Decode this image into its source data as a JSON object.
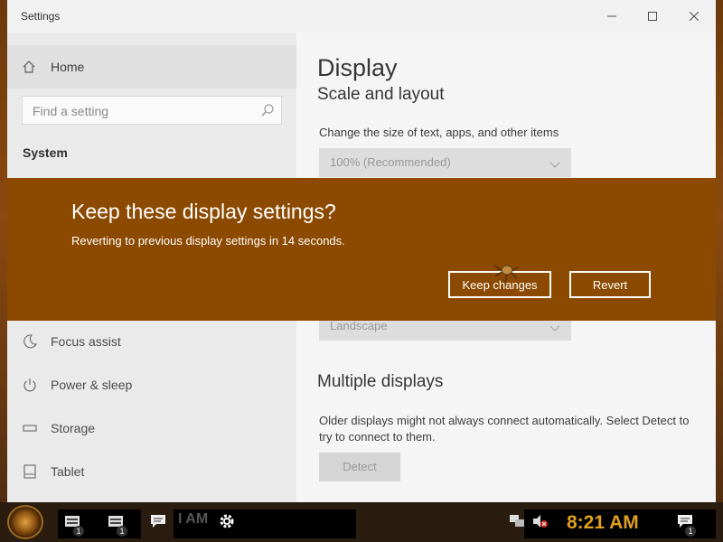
{
  "window": {
    "title": "Settings"
  },
  "sidebar": {
    "home_label": "Home",
    "search_placeholder": "Find a setting",
    "section_label": "System",
    "items": [
      {
        "label": "Focus assist",
        "icon": "moon-icon"
      },
      {
        "label": "Power & sleep",
        "icon": "power-icon"
      },
      {
        "label": "Storage",
        "icon": "storage-icon"
      },
      {
        "label": "Tablet",
        "icon": "tablet-icon"
      }
    ]
  },
  "content": {
    "heading": "Display",
    "scale_heading": "Scale and layout",
    "scale_desc": "Change the size of text, apps, and other items",
    "scale_value": "100% (Recommended)",
    "orientation_value": "Landscape",
    "multi_heading": "Multiple displays",
    "multi_desc": "Older displays might not always connect automatically. Select Detect to try to connect to them.",
    "detect_label": "Detect"
  },
  "dialog": {
    "title": "Keep these display settings?",
    "message": "Reverting to previous display settings in 14 seconds.",
    "keep_label": "Keep changes",
    "revert_label": "Revert"
  },
  "taskbar": {
    "faded_text": "I AM",
    "clock": "8:21 AM",
    "badge": "1"
  },
  "colors": {
    "dialog_bg": "#8c4a00",
    "clock_color": "#e0a020"
  }
}
